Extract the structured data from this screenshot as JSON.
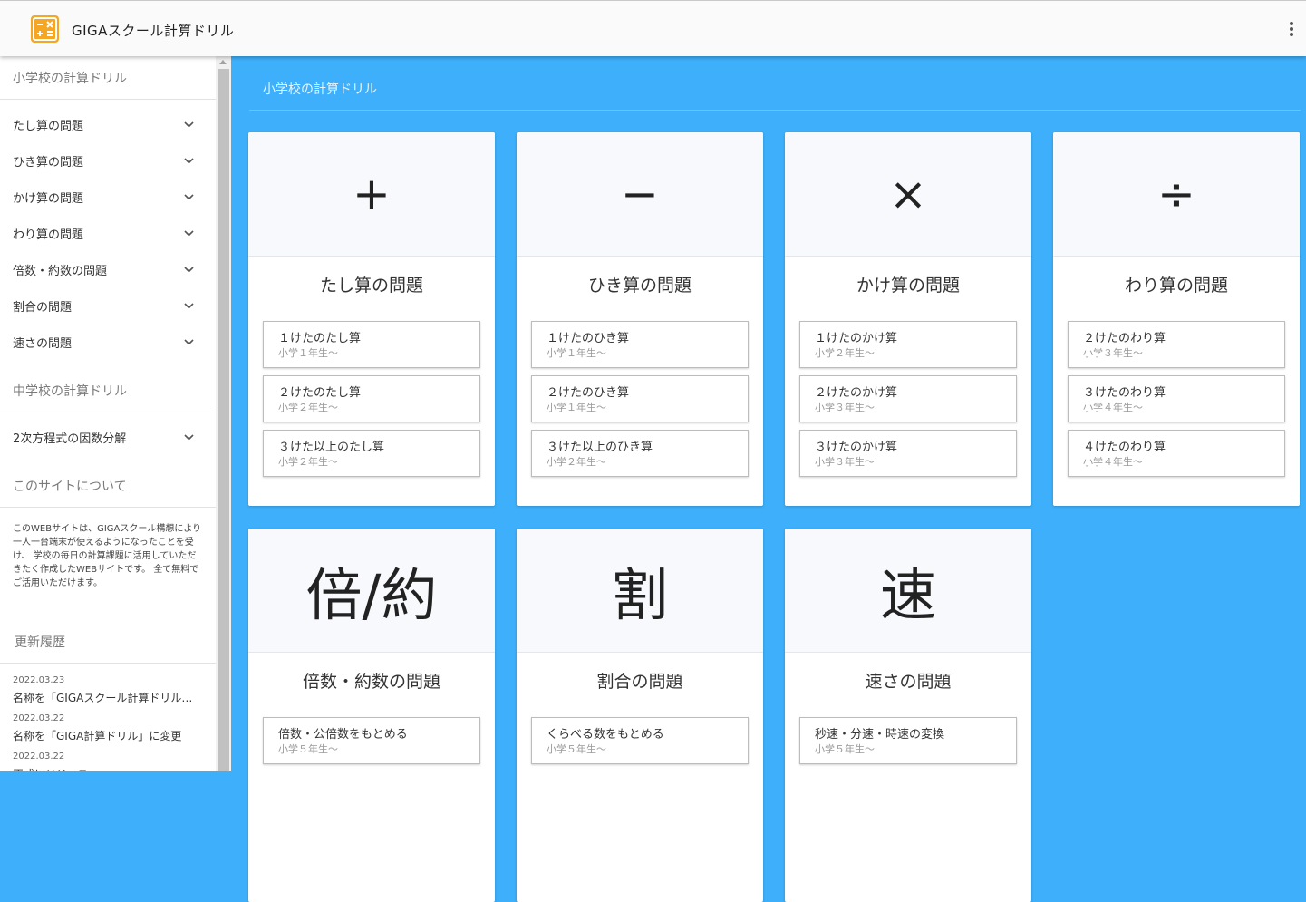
{
  "app": {
    "title": "GIGAスクール計算ドリル"
  },
  "sidebar": {
    "elementary_header": "小学校の計算ドリル",
    "elementary_items": [
      {
        "label": "たし算の問題"
      },
      {
        "label": "ひき算の問題"
      },
      {
        "label": "かけ算の問題"
      },
      {
        "label": "わり算の問題"
      },
      {
        "label": "倍数・約数の問題"
      },
      {
        "label": "割合の問題"
      },
      {
        "label": "速さの問題"
      }
    ],
    "junior_header": "中学校の計算ドリル",
    "junior_items": [
      {
        "label": "2次方程式の因数分解"
      }
    ],
    "about_header": "このサイトについて",
    "about_text": "このWEBサイトは、GIGAスクール構想により一人一台端末が使えるようになったことを受け、 学校の毎日の計算課題に活用していただきたく作成したWEBサイトです。 全て無料でご活用いただけます。",
    "history_header": "更新履歴",
    "history": [
      {
        "date": "2022.03.23",
        "text": "名称を「GIGAスクール計算ドリル」に変更"
      },
      {
        "date": "2022.03.22",
        "text": "名称を「GIGA計算ドリル」に変更"
      },
      {
        "date": "2022.03.22",
        "text": "正式にリリース"
      }
    ]
  },
  "main": {
    "title": "小学校の計算ドリル",
    "cards": [
      {
        "symbol": "+",
        "title": "たし算の問題",
        "items": [
          {
            "label": "１けたのたし算",
            "sub": "小学１年生～"
          },
          {
            "label": "２けたのたし算",
            "sub": "小学２年生～"
          },
          {
            "label": "３けた以上のたし算",
            "sub": "小学２年生～"
          }
        ]
      },
      {
        "symbol": "−",
        "title": "ひき算の問題",
        "items": [
          {
            "label": "１けたのひき算",
            "sub": "小学１年生～"
          },
          {
            "label": "２けたのひき算",
            "sub": "小学１年生～"
          },
          {
            "label": "３けた以上のひき算",
            "sub": "小学２年生～"
          }
        ]
      },
      {
        "symbol": "×",
        "title": "かけ算の問題",
        "items": [
          {
            "label": "１けたのかけ算",
            "sub": "小学２年生～"
          },
          {
            "label": "２けたのかけ算",
            "sub": "小学３年生～"
          },
          {
            "label": "３けたのかけ算",
            "sub": "小学３年生～"
          }
        ]
      },
      {
        "symbol": "÷",
        "title": "わり算の問題",
        "items": [
          {
            "label": "２けたのわり算",
            "sub": "小学３年生～"
          },
          {
            "label": "３けたのわり算",
            "sub": "小学４年生～"
          },
          {
            "label": "４けたのわり算",
            "sub": "小学４年生～"
          }
        ]
      },
      {
        "symbol": "倍/約",
        "title": "倍数・約数の問題",
        "items": [
          {
            "label": "倍数・公倍数をもとめる",
            "sub": "小学５年生～"
          }
        ]
      },
      {
        "symbol": "割",
        "title": "割合の問題",
        "items": [
          {
            "label": "くらべる数をもとめる",
            "sub": "小学５年生～"
          }
        ]
      },
      {
        "symbol": "速",
        "title": "速さの問題",
        "items": [
          {
            "label": "秒速・分速・時速の変換",
            "sub": "小学５年生～"
          }
        ]
      }
    ]
  },
  "icons": {
    "logo": "calculator-icon",
    "menu": "more-vert-icon",
    "expand": "chevron-down-icon"
  },
  "colors": {
    "main_bg": "#3eb0fb",
    "logo": "#f5a623"
  }
}
